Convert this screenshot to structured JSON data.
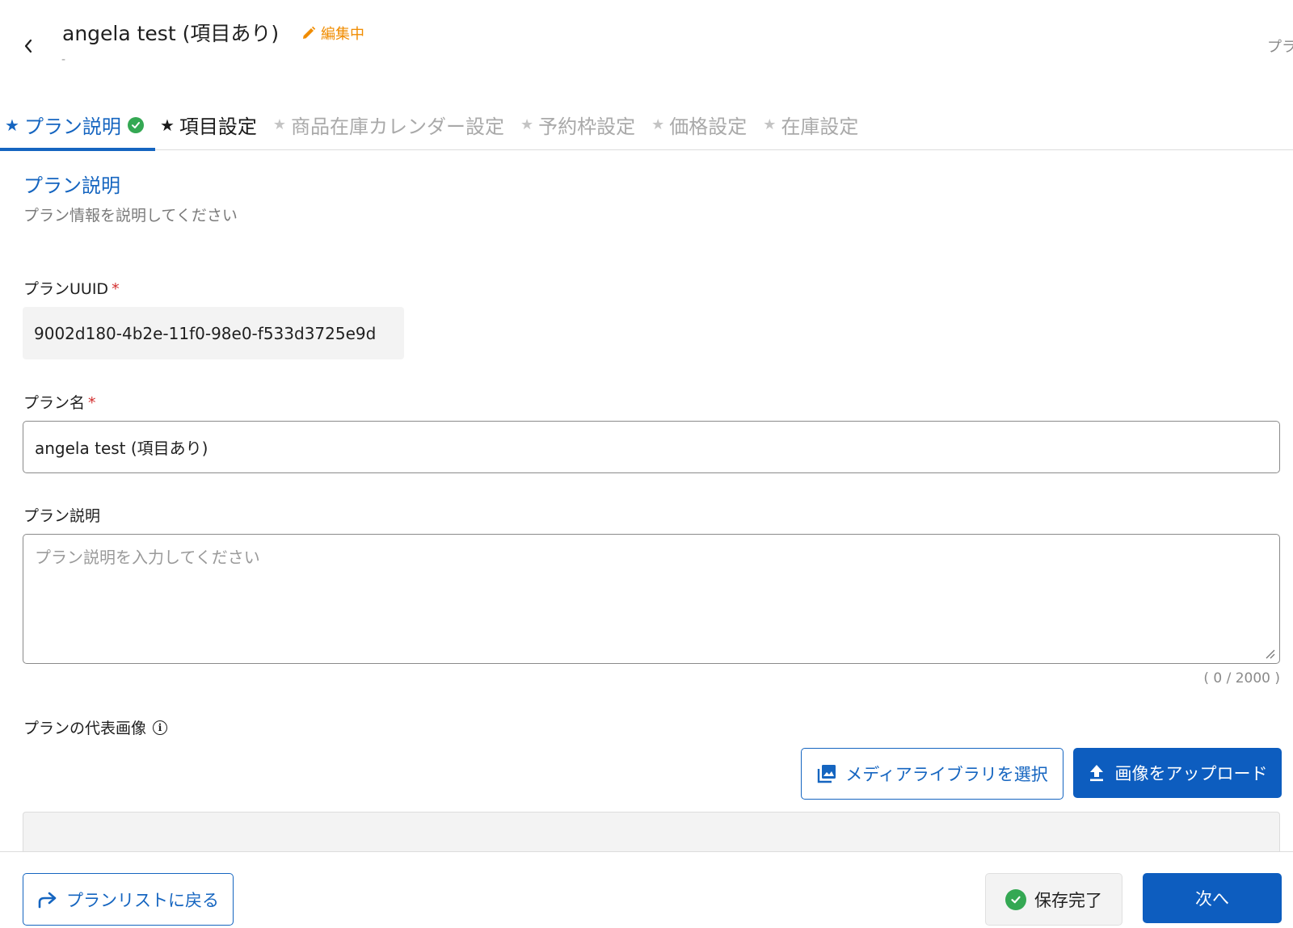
{
  "header": {
    "title": "angela test (項目あり)",
    "edit_status": "編集中",
    "subtitle": "-",
    "right_cut_text": "プラ"
  },
  "tabs": [
    {
      "label": "プラン説明",
      "state": "active"
    },
    {
      "label": "項目設定",
      "state": "done"
    },
    {
      "label": "商品在庫カレンダー設定",
      "state": "disabled"
    },
    {
      "label": "予約枠設定",
      "state": "disabled"
    },
    {
      "label": "価格設定",
      "state": "disabled"
    },
    {
      "label": "在庫設定",
      "state": "disabled"
    }
  ],
  "section": {
    "title": "プラン説明",
    "description": "プラン情報を説明してください"
  },
  "form": {
    "uuid_label": "プランUUID",
    "uuid_value": "9002d180-4b2e-11f0-98e0-f533d3725e9d",
    "name_label": "プラン名",
    "name_value": "angela test (項目あり)",
    "desc_label": "プラン説明",
    "desc_placeholder": "プラン説明を入力してください",
    "desc_count": "( 0 / 2000 )",
    "required_mark": "*",
    "image_label": "プランの代表画像",
    "media_button": "メディアライブラリを選択",
    "upload_button": "画像をアップロード"
  },
  "footer": {
    "back_list_button": "プランリストに戻る",
    "save_button": "保存完了",
    "next_button": "次へ"
  },
  "colors": {
    "primary": "#1565c0",
    "primary_button": "#0d5dbf",
    "warning": "#f08c00",
    "success": "#34a853",
    "required": "#d32f2f"
  }
}
